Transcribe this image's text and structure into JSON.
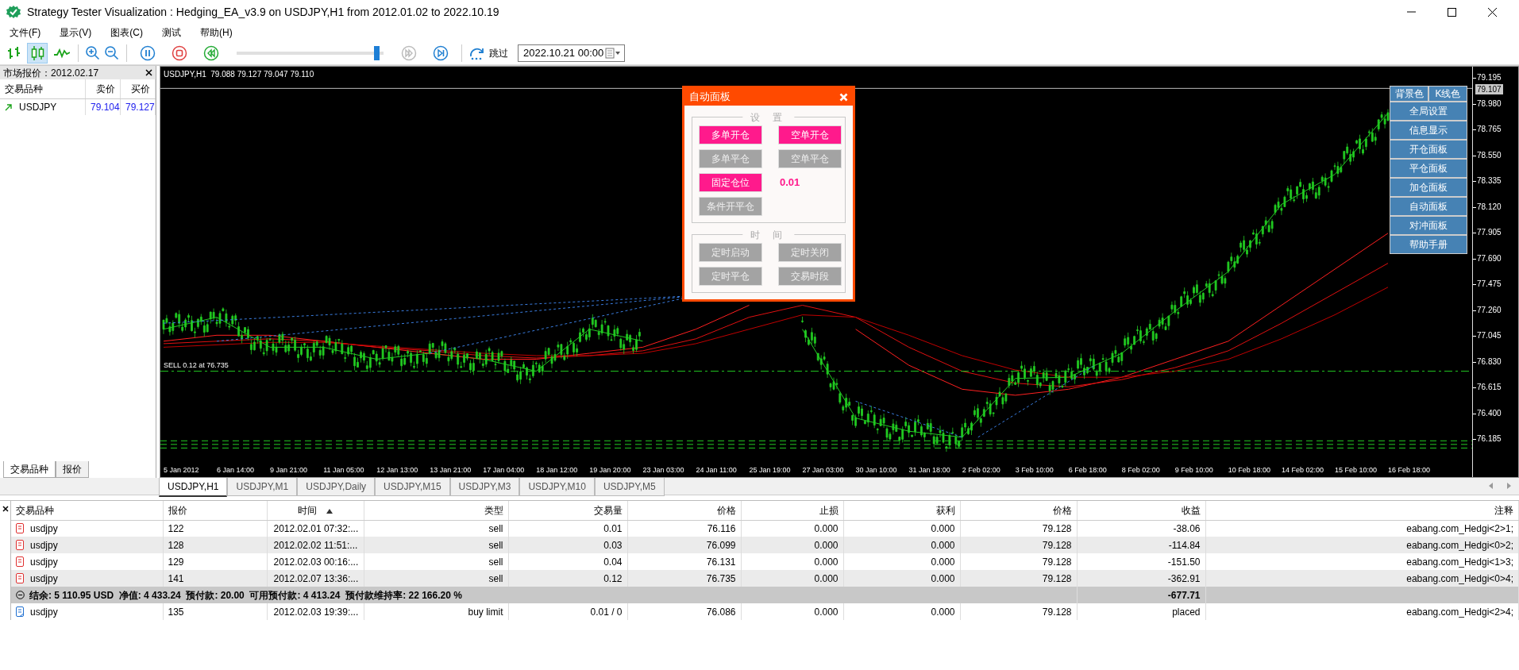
{
  "window": {
    "title": "Strategy Tester Visualization : Hedging_EA_v3.9 on USDJPY,H1 from 2012.01.02 to 2022.10.19"
  },
  "menu": [
    "文件(F)",
    "显示(V)",
    "图表(C)",
    "测试",
    "帮助(H)"
  ],
  "toolbar": {
    "chart_modes": [
      {
        "kind": "bars",
        "selected": false
      },
      {
        "kind": "candles",
        "selected": true
      },
      {
        "kind": "line",
        "selected": false
      }
    ],
    "playback": [
      {
        "kind": "pause",
        "disabled": false
      },
      {
        "kind": "stop",
        "disabled": false
      },
      {
        "kind": "rewind",
        "disabled": false
      }
    ],
    "speed_slider": {
      "level": 0.97
    },
    "playback_after": [
      {
        "kind": "fast_forward",
        "disabled": true
      },
      {
        "kind": "skip_end",
        "disabled": false
      }
    ],
    "skip_label": "跳过",
    "skip_date": "2022.10.21 00:00"
  },
  "market_watch": {
    "title": "市场报价：2012.02.17",
    "columns": [
      "交易品种",
      "卖价",
      "买价"
    ],
    "rows": [
      {
        "symbol": "USDJPY",
        "bid": "79.104",
        "ask": "79.127"
      }
    ],
    "tabs": [
      {
        "label": "交易品种",
        "selected": true
      },
      {
        "label": "报价",
        "selected": false
      }
    ]
  },
  "chart": {
    "info": "USDJPY,H1  79.088 79.127 79.047 79.110",
    "trade_label": "SELL 0.12 at 76.735",
    "current_price": "79.107",
    "chart_data": {
      "type": "line",
      "categories": [
        "5 Jan 2012",
        "6 Jan 14:00",
        "9 Jan 21:00",
        "11 Jan 05:00",
        "12 Jan 13:00",
        "13 Jan 21:00",
        "17 Jan 04:00",
        "18 Jan 12:00",
        "19 Jan 20:00",
        "23 Jan 03:00",
        "24 Jan 11:00",
        "25 Jan 19:00",
        "27 Jan 03:00",
        "30 Jan 10:00",
        "31 Jan 18:00",
        "2 Feb 02:00",
        "3 Feb 10:00",
        "6 Feb 18:00",
        "8 Feb 02:00",
        "9 Feb 10:00",
        "10 Feb 18:00",
        "14 Feb 02:00",
        "15 Feb 10:00",
        "16 Feb 18:00"
      ],
      "yticks": [
        {
          "value": 79.195,
          "label": "79.195"
        },
        {
          "value": 78.98,
          "label": "78.980"
        },
        {
          "value": 78.765,
          "label": "78.765"
        },
        {
          "value": 78.55,
          "label": "78.550"
        },
        {
          "value": 78.335,
          "label": "78.335"
        },
        {
          "value": 78.12,
          "label": "78.120"
        },
        {
          "value": 77.905,
          "label": "77.905"
        },
        {
          "value": 77.69,
          "label": "77.690"
        },
        {
          "value": 77.475,
          "label": "77.475"
        },
        {
          "value": 77.26,
          "label": "77.260"
        },
        {
          "value": 77.045,
          "label": "77.045"
        },
        {
          "value": 76.83,
          "label": "76.830"
        },
        {
          "value": 76.615,
          "label": "76.615"
        },
        {
          "value": 76.4,
          "label": "76.400"
        },
        {
          "value": 76.185,
          "label": "76.185"
        }
      ],
      "ylim": [
        75.861,
        79.288
      ],
      "series": [
        {
          "color": "#22cc22",
          "values": [
            77.1,
            77.2,
            76.95,
            76.95,
            76.85,
            76.9,
            76.85,
            76.75,
            77.1,
            77.0,
            null,
            null,
            77.1,
            76.36,
            76.25,
            76.2,
            76.69,
            76.7,
            76.9,
            77.25,
            77.58,
            78.14,
            78.39,
            78.9
          ]
        },
        {
          "color": "#ff2020",
          "values": [
            77.0,
            77.05,
            77.05,
            77.0,
            76.95,
            76.9,
            76.85,
            76.85,
            76.9,
            76.95,
            77.1,
            77.3,
            null,
            77.1,
            76.8,
            76.6,
            76.55,
            76.6,
            76.7,
            76.85,
            77.0,
            77.3,
            77.6,
            77.9
          ]
        },
        {
          "color": "#e01010",
          "values": [
            76.98,
            77.0,
            77.02,
            77.0,
            76.95,
            76.92,
            76.88,
            76.86,
            76.88,
            76.92,
            77.02,
            77.2,
            77.3,
            77.2,
            76.95,
            76.75,
            76.65,
            76.62,
            76.68,
            76.78,
            76.92,
            77.15,
            77.4,
            77.65
          ]
        },
        {
          "color": "#c00000",
          "values": [
            76.95,
            76.97,
            76.99,
            76.99,
            76.96,
            76.93,
            76.9,
            76.88,
            76.88,
            76.9,
            76.98,
            77.1,
            77.22,
            77.2,
            77.05,
            76.88,
            76.76,
            76.7,
            76.7,
            76.75,
            76.85,
            77.02,
            77.22,
            77.45
          ]
        }
      ]
    },
    "tabs": [
      {
        "label": "USDJPY,H1",
        "selected": true
      },
      {
        "label": "USDJPY,M1",
        "selected": false
      },
      {
        "label": "USDJPY,Daily",
        "selected": false
      },
      {
        "label": "USDJPY,M15",
        "selected": false
      },
      {
        "label": "USDJPY,M3",
        "selected": false
      },
      {
        "label": "USDJPY,M10",
        "selected": false
      },
      {
        "label": "USDJPY,M5",
        "selected": false
      }
    ]
  },
  "auto_panel": {
    "title": "自动面板",
    "groups": [
      {
        "title": "设 置",
        "items": [
          {
            "kind": "button",
            "label": "多单开仓",
            "on": true
          },
          {
            "kind": "button",
            "label": "空单开仓",
            "on": true
          },
          {
            "kind": "button",
            "label": "多单平仓",
            "on": false
          },
          {
            "kind": "button",
            "label": "空单平仓",
            "on": false
          },
          {
            "kind": "button",
            "label": "固定仓位",
            "on": true
          },
          {
            "kind": "value",
            "label": "0.01"
          },
          {
            "kind": "button",
            "label": "条件开平仓",
            "on": false
          }
        ]
      },
      {
        "title": "时 间",
        "items": [
          {
            "kind": "button",
            "label": "定时启动",
            "on": false
          },
          {
            "kind": "button",
            "label": "定时关闭",
            "on": false
          },
          {
            "kind": "button",
            "label": "定时平仓",
            "on": false
          },
          {
            "kind": "button",
            "label": "交易时段",
            "on": false
          }
        ]
      }
    ]
  },
  "side_buttons": {
    "top": [
      "背景色",
      "K线色"
    ],
    "items": [
      "全局设置",
      "信息显示",
      "开仓面板",
      "平仓面板",
      "加仓面板",
      "自动面板",
      "对冲面板",
      "帮助手册"
    ]
  },
  "terminal": {
    "columns": [
      {
        "label": "交易品种"
      },
      {
        "label": "报价"
      },
      {
        "label": "时间",
        "sorted": true
      },
      {
        "label": "类型"
      },
      {
        "label": "交易量"
      },
      {
        "label": "价格"
      },
      {
        "label": "止损"
      },
      {
        "label": "获利"
      },
      {
        "label": "价格"
      },
      {
        "label": "收益"
      },
      {
        "label": "注释"
      }
    ],
    "rows": [
      {
        "kind": "position",
        "cells": [
          "usdjpy",
          "122",
          "2012.02.01 07:32:...",
          "sell",
          "0.01",
          "76.116",
          "0.000",
          "0.000",
          "79.128",
          "-38.06",
          "eabang.com_Hedgi<2>1;"
        ]
      },
      {
        "kind": "position",
        "cells": [
          "usdjpy",
          "128",
          "2012.02.02 11:51:...",
          "sell",
          "0.03",
          "76.099",
          "0.000",
          "0.000",
          "79.128",
          "-114.84",
          "eabang.com_Hedgi<0>2;"
        ]
      },
      {
        "kind": "position",
        "cells": [
          "usdjpy",
          "129",
          "2012.02.03 00:16:...",
          "sell",
          "0.04",
          "76.131",
          "0.000",
          "0.000",
          "79.128",
          "-151.50",
          "eabang.com_Hedgi<1>3;"
        ]
      },
      {
        "kind": "position",
        "cells": [
          "usdjpy",
          "141",
          "2012.02.07 13:36:...",
          "sell",
          "0.12",
          "76.735",
          "0.000",
          "0.000",
          "79.128",
          "-362.91",
          "eabang.com_Hedgi<0>4;"
        ]
      },
      {
        "kind": "summary",
        "text": "结余: 5 110.95 USD  净值: 4 433.24  预付款: 20.00  可用预付款: 4 413.24  预付款维持率: 22 166.20 %",
        "profit": "-677.71"
      },
      {
        "kind": "order",
        "cells": [
          "usdjpy",
          "135",
          "2012.02.03 19:39:...",
          "buy limit",
          "0.01 / 0",
          "76.086",
          "0.000",
          "0.000",
          "79.128",
          "placed",
          "eabang.com_Hedgi<2>4;"
        ]
      }
    ]
  }
}
